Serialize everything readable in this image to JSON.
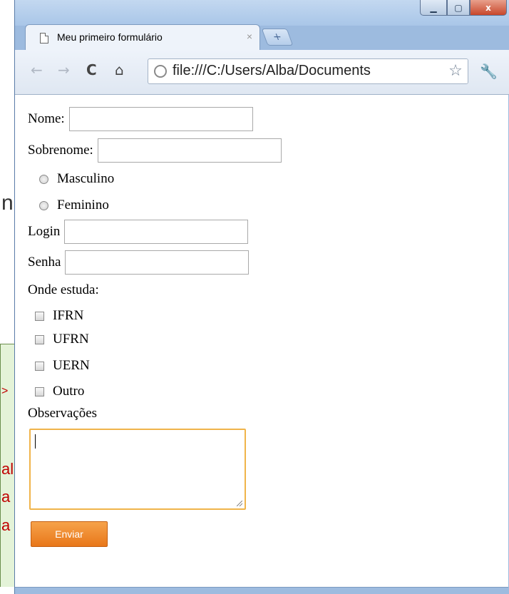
{
  "background": {
    "fragments": [
      "n",
      ">",
      "al",
      "a",
      "a"
    ]
  },
  "window": {
    "controls": {
      "minimize": "▁",
      "maximize": "▢",
      "close": "x"
    }
  },
  "tab": {
    "title": "Meu primeiro formulário",
    "close": "×",
    "new_tab": "+"
  },
  "toolbar": {
    "back": "←",
    "forward": "→",
    "reload": "C",
    "home": "⌂",
    "url": "file:///C:/Users/Alba/Documents",
    "star": "☆",
    "wrench": "🔧"
  },
  "form": {
    "nome_label": "Nome:",
    "sobrenome_label": "Sobrenome:",
    "sexo_options": [
      "Masculino",
      "Feminino"
    ],
    "login_label": "Login",
    "senha_label": "Senha",
    "onde_estuda_label": "Onde estuda:",
    "escolas": [
      "IFRN",
      "UFRN",
      "UERN",
      "Outro"
    ],
    "observacoes_label": "Observações",
    "submit_label": "Enviar"
  },
  "colors": {
    "accent": "#e8771a",
    "focus_border": "#f0b44a",
    "window_frame": "#9dbbdf"
  }
}
